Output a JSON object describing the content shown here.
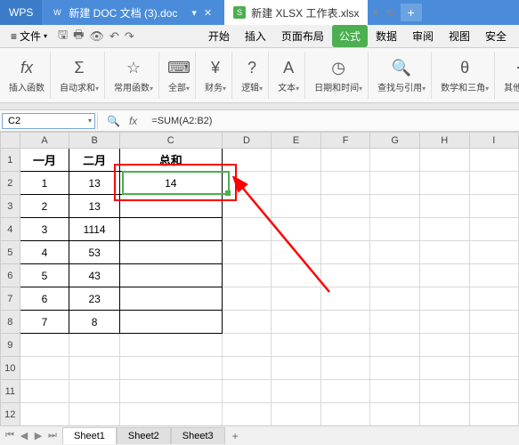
{
  "titlebar": {
    "app": "WPS",
    "tab1": "新建 DOC 文档 (3).doc",
    "tab2": "新建 XLSX 工作表.xlsx"
  },
  "menubar": {
    "file": "文件",
    "menus": [
      "开始",
      "插入",
      "页面布局",
      "公式",
      "数据",
      "审阅",
      "视图",
      "安全"
    ]
  },
  "ribbon": {
    "g0": "插入函数",
    "g1": "自动求和",
    "g2": "常用函数",
    "g3": "全部",
    "g4": "财务",
    "g5": "逻辑",
    "g6": "文本",
    "g7": "日期和时间",
    "g8": "查找与引用",
    "g9": "数学和三角",
    "g10": "其他函数"
  },
  "formulabar": {
    "cellref": "C2",
    "formula": "=SUM(A2:B2)"
  },
  "headers": {
    "A": "一月",
    "B": "二月",
    "C": "总和"
  },
  "cols": [
    "A",
    "B",
    "C",
    "D",
    "E",
    "F",
    "G",
    "H",
    "I"
  ],
  "rows": [
    {
      "A": "1",
      "B": "13",
      "C": "14"
    },
    {
      "A": "2",
      "B": "13",
      "C": ""
    },
    {
      "A": "3",
      "B": "1114",
      "C": ""
    },
    {
      "A": "4",
      "B": "53",
      "C": ""
    },
    {
      "A": "5",
      "B": "43",
      "C": ""
    },
    {
      "A": "6",
      "B": "23",
      "C": ""
    },
    {
      "A": "7",
      "B": "8",
      "C": ""
    }
  ],
  "chart_data": {
    "type": "table",
    "columns": [
      "一月",
      "二月",
      "总和"
    ],
    "rows": [
      [
        1,
        13,
        14
      ],
      [
        2,
        13,
        null
      ],
      [
        3,
        1114,
        null
      ],
      [
        4,
        53,
        null
      ],
      [
        5,
        43,
        null
      ],
      [
        6,
        23,
        null
      ],
      [
        7,
        8,
        null
      ]
    ]
  },
  "sheettabs": [
    "Sheet1",
    "Sheet2",
    "Sheet3"
  ]
}
